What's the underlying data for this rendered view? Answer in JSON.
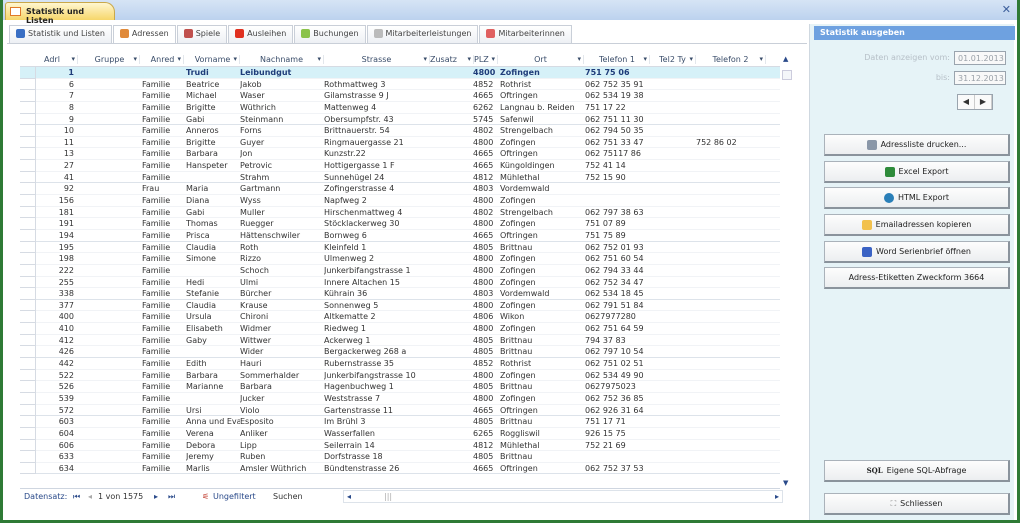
{
  "window": {
    "doc_tab": "Statistik und Listen",
    "close": "✕"
  },
  "tabs": [
    {
      "label": "Statistik und Listen",
      "icon": "bar-chart-icon",
      "color": "#3a6fc4"
    },
    {
      "label": "Adressen",
      "icon": "user-icon",
      "color": "#e08a3a"
    },
    {
      "label": "Spiele",
      "icon": "dice-icon",
      "color": "#c0504d"
    },
    {
      "label": "Ausleihen",
      "icon": "arrow-right-icon",
      "color": "#e03020"
    },
    {
      "label": "Buchungen",
      "icon": "eraser-icon",
      "color": "#8bc34a"
    },
    {
      "label": "Mitarbeiterleistungen",
      "icon": "plus-circle-icon",
      "color": "#bbbbbb"
    },
    {
      "label": "Mitarbeiterinnen",
      "icon": "person-icon",
      "color": "#e06060"
    }
  ],
  "active_tab": 1,
  "grid": {
    "columns": [
      "Adrl",
      "Gruppe",
      "Anred",
      "Vorname",
      "Nachname",
      "Strasse",
      "Zusatz",
      "PLZ",
      "Ort",
      "Telefon 1",
      "Tel2 Ty",
      "Telefon 2"
    ],
    "rows": [
      [
        "1",
        "",
        "",
        "Trudi",
        "Leibundgut",
        "",
        "",
        "4800",
        "Zofingen",
        "751 75 06",
        "",
        ""
      ],
      [
        "6",
        "",
        "Familie",
        "Beatrice",
        "Jakob",
        "Rothmattweg 3",
        "",
        "4852",
        "Rothrist",
        "062 752 35 91",
        "",
        ""
      ],
      [
        "7",
        "",
        "Familie",
        "Michael",
        "Waser",
        "Gilamstrasse 9 J",
        "",
        "4665",
        "Oftringen",
        "062  534 19 38",
        "",
        ""
      ],
      [
        "8",
        "",
        "Familie",
        "Brigitte",
        "Wüthrich",
        "Mattenweg 4",
        "",
        "6262",
        "Langnau b. Reiden",
        "751 17 22",
        "",
        ""
      ],
      [
        "9",
        "",
        "Familie",
        "Gabi",
        "Steinmann",
        "Obersumpfstr. 43",
        "",
        "5745",
        "Safenwil",
        "062 751 11 30",
        "",
        ""
      ],
      [
        "10",
        "",
        "Familie",
        "Anneros",
        "Forns",
        "Brittnauerstr. 54",
        "",
        "4802",
        "Strengelbach",
        "062 794 50 35",
        "",
        ""
      ],
      [
        "11",
        "",
        "Familie",
        "Brigitte",
        "Guyer",
        "Ringmauergasse 21",
        "",
        "4800",
        "Zofingen",
        "062 751 33 47",
        "",
        "752 86 02"
      ],
      [
        "13",
        "",
        "Familie",
        "Barbara",
        "Jon",
        "Kunzstr.22",
        "",
        "4665",
        "Oftringen",
        "062 75117 86",
        "",
        ""
      ],
      [
        "27",
        "",
        "Familie",
        "Hanspeter",
        "Petrovic",
        "Hottigergasse 1 F",
        "",
        "4665",
        "Küngoldingen",
        "752 41 14",
        "",
        ""
      ],
      [
        "41",
        "",
        "Familie",
        "",
        "Strahm",
        "Sunnehügel 24",
        "",
        "4812",
        "Mühlethal",
        "752 15 90",
        "",
        ""
      ],
      [
        "92",
        "",
        "Frau",
        "Maria",
        "Gartmann",
        "Zofingerstrasse 4",
        "",
        "4803",
        "Vordemwald",
        "",
        "",
        ""
      ],
      [
        "156",
        "",
        "Familie",
        "Diana",
        "Wyss",
        "Napfweg 2",
        "",
        "4800",
        "Zofingen",
        "",
        "",
        ""
      ],
      [
        "181",
        "",
        "Familie",
        "Gabi",
        "Muller",
        "Hirschenmattweg 4",
        "",
        "4802",
        "Strengelbach",
        "062  797 38 63",
        "",
        ""
      ],
      [
        "191",
        "",
        "Familie",
        "Thomas",
        "Ruegger",
        "Stöcklackerweg 30",
        "",
        "4800",
        "Zofingen",
        "751 07 89",
        "",
        ""
      ],
      [
        "194",
        "",
        "Familie",
        "Prisca",
        "Hättenschwiler",
        "Bornweg 6",
        "",
        "4665",
        "Oftringen",
        "751 75 89",
        "",
        ""
      ],
      [
        "195",
        "",
        "Familie",
        "Claudia",
        "Roth",
        "Kleinfeld 1",
        "",
        "4805",
        "Brittnau",
        "062  752 01 93",
        "",
        ""
      ],
      [
        "198",
        "",
        "Familie",
        "Simone",
        "Rizzo",
        "Ulmenweg 2",
        "",
        "4800",
        "Zofingen",
        "062  751 60 54",
        "",
        ""
      ],
      [
        "222",
        "",
        "Familie",
        "",
        "Schoch",
        "Junkerbifangstrasse 1",
        "",
        "4800",
        "Zofingen",
        "062 794 33 44",
        "",
        ""
      ],
      [
        "255",
        "",
        "Familie",
        "Hedi",
        "Ulmi",
        "Innere Altachen 15",
        "",
        "4800",
        "Zofingen",
        "062  752 34 47",
        "",
        ""
      ],
      [
        "338",
        "",
        "Familie",
        "Stefanie",
        "Bürcher",
        "Kührain 36",
        "",
        "4803",
        "Vordemwald",
        "062  534 18 45",
        "",
        ""
      ],
      [
        "377",
        "",
        "Familie",
        "Claudia",
        "Krause",
        "Sonnenweg 5",
        "",
        "4800",
        "Zofingen",
        "062 791 51 84",
        "",
        ""
      ],
      [
        "400",
        "",
        "Familie",
        "Ursula",
        "Chironi",
        "Altkematte 2",
        "",
        "4806",
        "Wikon",
        "0627977280",
        "",
        ""
      ],
      [
        "410",
        "",
        "Familie",
        "Elisabeth",
        "Widmer",
        "Riedweg 1",
        "",
        "4800",
        "Zofingen",
        "062  751 64 59",
        "",
        ""
      ],
      [
        "412",
        "",
        "Familie",
        "Gaby",
        "Wittwer",
        "Ackerweg 1",
        "",
        "4805",
        "Brittnau",
        "794 37 83",
        "",
        ""
      ],
      [
        "426",
        "",
        "Familie",
        "",
        "Wider",
        "Bergackerweg 268 a",
        "",
        "4805",
        "Brittnau",
        "062 797 10 54",
        "",
        ""
      ],
      [
        "442",
        "",
        "Familie",
        "Edith",
        "Hauri",
        "Rubernstrasse 35",
        "",
        "4852",
        "Rothrist",
        "062 751 02 51",
        "",
        ""
      ],
      [
        "522",
        "",
        "Familie",
        "Barbara",
        "Sommerhalder",
        "Junkerbifangstrasse 10",
        "",
        "4800",
        "Zofingen",
        "062 534 49 90",
        "",
        ""
      ],
      [
        "526",
        "",
        "Familie",
        "Marianne",
        "Barbara",
        "Hagenbuchweg 1",
        "",
        "4805",
        "Brittnau",
        "0627975023",
        "",
        ""
      ],
      [
        "539",
        "",
        "Familie",
        "",
        "Jucker",
        "Weststrasse 7",
        "",
        "4800",
        "Zofingen",
        "062 752 36 85",
        "",
        ""
      ],
      [
        "572",
        "",
        "Familie",
        "Ursi",
        "Violo",
        "Gartenstrasse 11",
        "",
        "4665",
        "Oftringen",
        "062 926 31 64",
        "",
        ""
      ],
      [
        "603",
        "",
        "Familie",
        "Anna und Eva",
        "Esposito",
        "Im Brühl 3",
        "",
        "4805",
        "Brittnau",
        "751 17 71",
        "",
        ""
      ],
      [
        "604",
        "",
        "Familie",
        "Verena",
        "Anliker",
        "Wasserfallen",
        "",
        "6265",
        "Roggliswil",
        "926 15 75",
        "",
        ""
      ],
      [
        "606",
        "",
        "Familie",
        "Debora",
        "Lipp",
        "Seilerrain 14",
        "",
        "4812",
        "Mühlethal",
        "752 21 69",
        "",
        ""
      ],
      [
        "633",
        "",
        "Familie",
        "Jeremy",
        "Ruben",
        "Dorfstrasse 18",
        "",
        "4805",
        "Brittnau",
        "",
        "",
        ""
      ],
      [
        "634",
        "",
        "Familie",
        "Marlis",
        "Amsler Wüthrich",
        "Bündtenstrasse 26",
        "",
        "4665",
        "Oftringen",
        "062 752 37 53",
        "",
        ""
      ]
    ]
  },
  "navigation": {
    "label": "Datensatz:",
    "first": "⏮",
    "prev": "◂",
    "position": "1 von 1575",
    "next": "▸",
    "last": "⏭",
    "filter": "Ungefiltert",
    "search": "Suchen"
  },
  "panel": {
    "title": "Statistik ausgeben",
    "from_label": "Daten anzeigen vom:",
    "from_value": "01.01.2013",
    "to_label": "bis:",
    "to_value": "31.12.2013",
    "prev": "◀",
    "next": "▶",
    "buttons": [
      {
        "label": "Adressliste drucken...",
        "icon": "printer-icon",
        "color": "#8a97a8"
      },
      {
        "label": "Excel Export",
        "icon": "excel-icon",
        "color": "#2e8b3a"
      },
      {
        "label": "HTML Export",
        "icon": "globe-icon",
        "color": "#2a7fb8"
      },
      {
        "label": "Emailadressen kopieren",
        "icon": "email-icon",
        "color": "#f2c14e"
      },
      {
        "label": "Word Serienbrief öffnen",
        "icon": "word-icon",
        "color": "#3a62c4"
      },
      {
        "label": "Adress-Etiketten Zweckform 3664",
        "icon": "",
        "color": ""
      }
    ],
    "sql_button": "Eigene SQL-Abfrage",
    "sql_icon_text": "SQL",
    "close_button": "Schliessen",
    "close_icon": "⛶"
  }
}
